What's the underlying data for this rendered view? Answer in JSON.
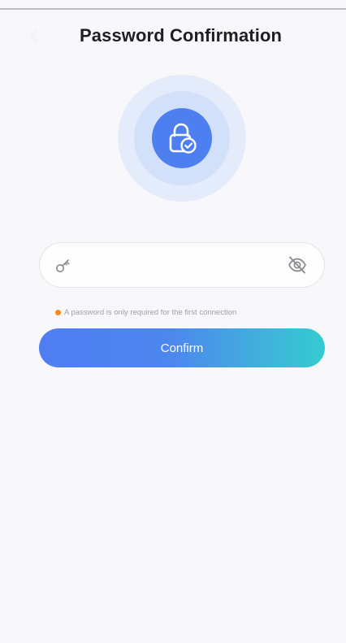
{
  "header": {
    "title": "Password Confirmation",
    "back_icon": "chevron-left-icon"
  },
  "hero": {
    "icon": "lock-check-icon",
    "accent_color": "#4d7ff0",
    "halo_colors": [
      "#e4ecfb",
      "#d3e0fa"
    ]
  },
  "password": {
    "leading_icon": "key-icon",
    "value": "",
    "placeholder": "",
    "visibility_icon": "eye-off-icon"
  },
  "hint": {
    "text": "A password is only required for the first connection",
    "dot_color": "#f28a1e"
  },
  "confirm": {
    "label": "Confirm",
    "gradient": [
      "#4f7ef3",
      "#34ccd0"
    ]
  }
}
